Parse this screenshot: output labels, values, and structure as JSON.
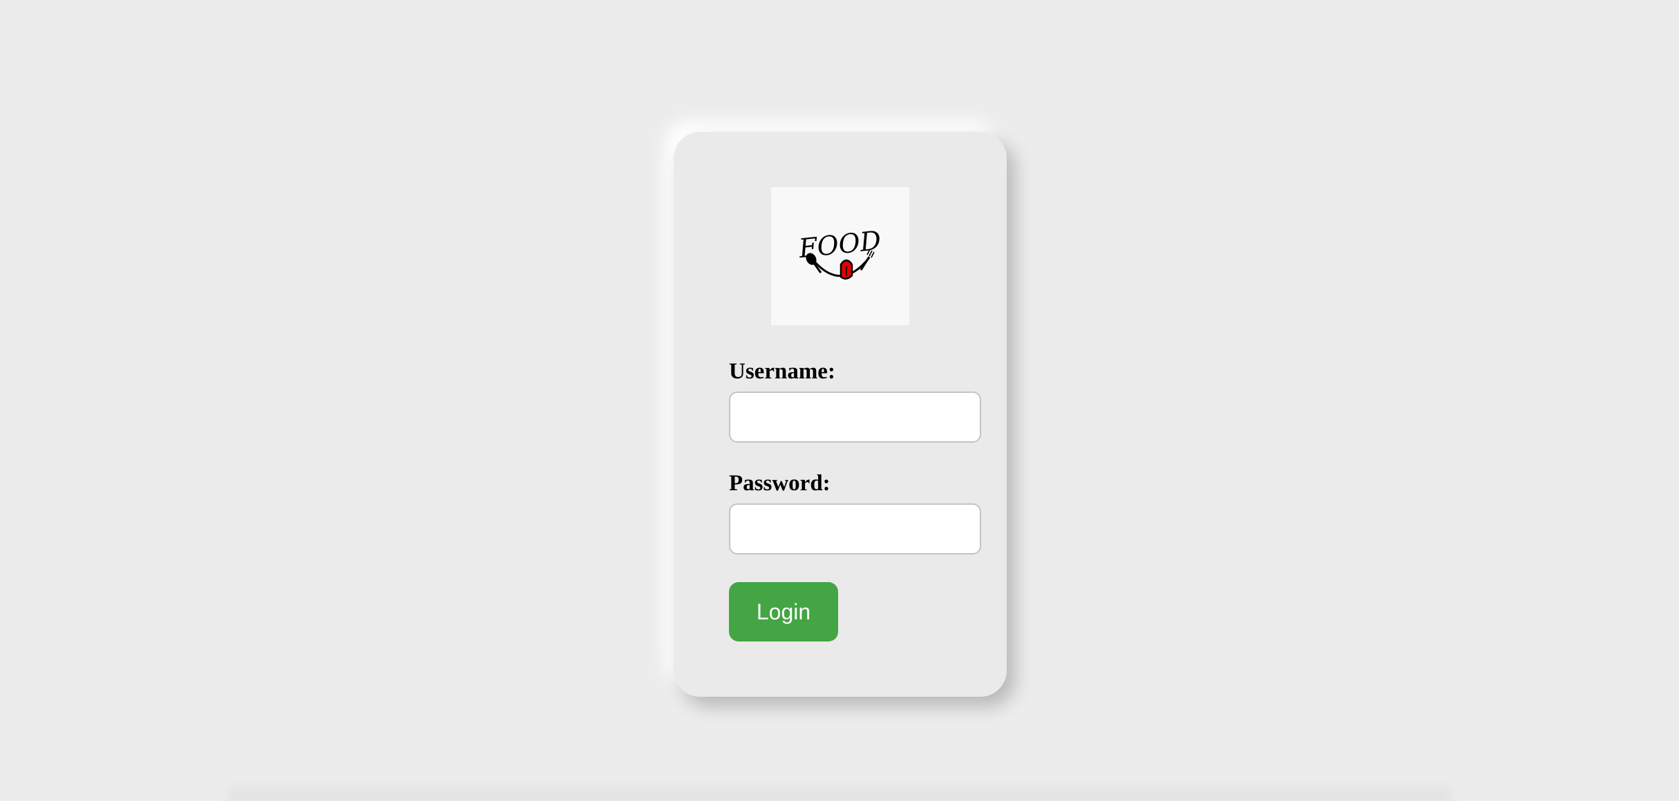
{
  "logo": {
    "text": "FOOD",
    "icon": "food-smile-logo",
    "accent_color": "#e00000"
  },
  "form": {
    "username_label": "Username:",
    "username_value": "",
    "password_label": "Password:",
    "password_value": "",
    "login_label": "Login"
  },
  "colors": {
    "background": "#ececec",
    "card": "#eaeaea",
    "login_button": "#43a543"
  }
}
